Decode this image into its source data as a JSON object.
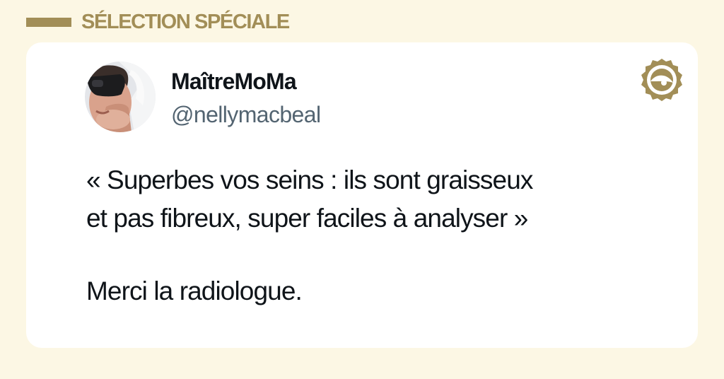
{
  "header": {
    "section_label": "SÉLECTION SPÉCIALE"
  },
  "tweet": {
    "author_name": "MaîtreMoMa",
    "author_handle": "@nellymacbeal",
    "text_lines": [
      "« Superbes vos seins : ils sont graisseux",
      "et pas fibreux, super faciles à analyser »",
      "Merci la radiologue."
    ]
  },
  "icons": {
    "avatar": "profile-photo",
    "brand": "seal-eye-logo"
  },
  "colors": {
    "background": "#FCF7E4",
    "accent_gold": "#A28E57",
    "card": "#FFFFFF",
    "text_primary": "#0F1419",
    "text_secondary": "#536471"
  }
}
